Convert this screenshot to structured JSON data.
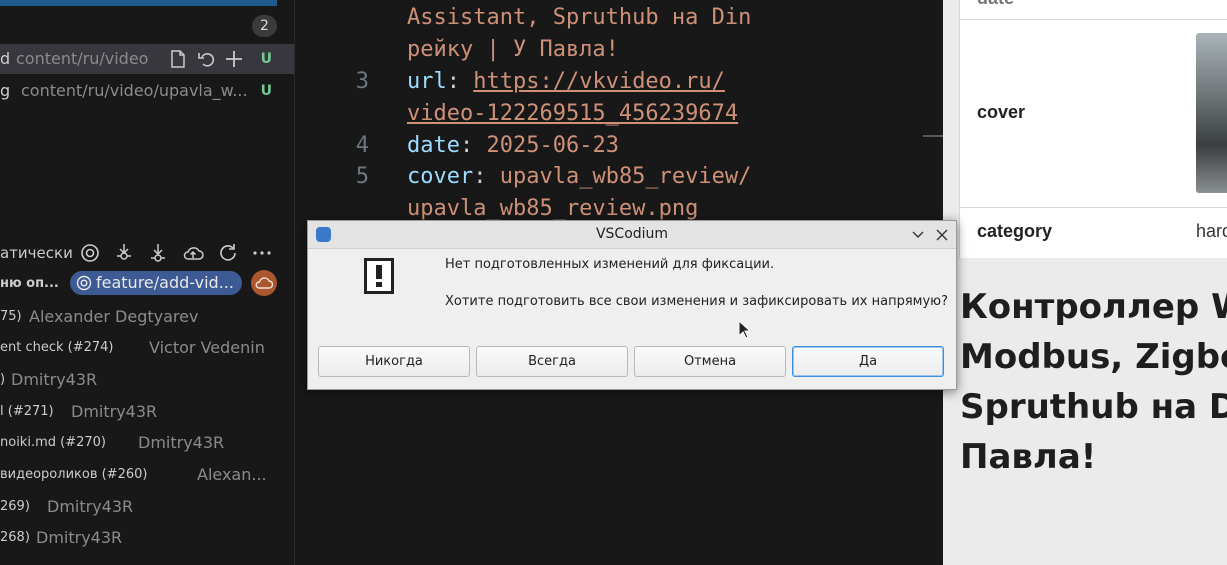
{
  "sidebar": {
    "changes_count": "2",
    "files": [
      {
        "name": "d",
        "path": "content/ru/video",
        "status": "U"
      },
      {
        "name": "g",
        "path": "content/ru/video/upavla_w...",
        "status": "U"
      }
    ],
    "graph_label": "атически",
    "commits": [
      {
        "message": "ню оп...",
        "branch": "feature/add-vid...",
        "author": ""
      },
      {
        "message": "75)",
        "author": "Alexander Degtyarev"
      },
      {
        "message": "ent check (#274)",
        "author": "Victor Vedenin"
      },
      {
        "message": ")",
        "author": "Dmitry43R"
      },
      {
        "message": "l (#271)",
        "author": "Dmitry43R"
      },
      {
        "message": "noiki.md (#270)",
        "author": "Dmitry43R"
      },
      {
        "message": "видеороликов (#260)",
        "author": "Alexan..."
      },
      {
        "message": "269)",
        "author": "Dmitry43R"
      },
      {
        "message": "268)",
        "author": "Dmitry43R"
      }
    ]
  },
  "editor": {
    "lines": [
      {
        "num": "",
        "text": "Assistant, Spruthub на Din"
      },
      {
        "num": "",
        "text": "рейку | У Павла!"
      },
      {
        "num": "3",
        "key": "url",
        "link": "https://vkvideo.ru/"
      },
      {
        "num": "",
        "link": "video-122269515_456239674"
      },
      {
        "num": "4",
        "key": "date",
        "value": "2025-06-23"
      },
      {
        "num": "5",
        "key": "cover",
        "value": "upavla_wb85_review/"
      },
      {
        "num": "",
        "value": "upavla_wb85_review.png"
      }
    ]
  },
  "preview": {
    "rows": [
      {
        "key": "date"
      },
      {
        "key": "cover"
      },
      {
        "key": "category",
        "value": "hard"
      }
    ],
    "title": "Контроллер W\nModbus, Zigbee\nSpruthub на Di\nПавла!"
  },
  "dialog": {
    "title": "VSCodium",
    "message": "Нет подготовленных изменений для фиксации.",
    "question": "Хотите подготовить все свои изменения и зафиксировать их напрямую?",
    "buttons": {
      "never": "Никогда",
      "always": "Всегда",
      "cancel": "Отмена",
      "yes": "Да"
    }
  }
}
